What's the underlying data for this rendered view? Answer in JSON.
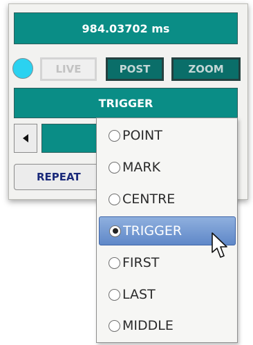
{
  "display": {
    "time": "984.03702 ms"
  },
  "modes": {
    "live": "LIVE",
    "post": "POST",
    "zoom": "ZOOM",
    "led_color": "#2bd2f0"
  },
  "trigger_select": {
    "value": "TRIGGER"
  },
  "repeat_button": {
    "label": "REPEAT"
  },
  "dropdown": {
    "options": [
      "POINT",
      "MARK",
      "CENTRE",
      "TRIGGER",
      "FIRST",
      "LAST",
      "MIDDLE"
    ],
    "selected": "TRIGGER"
  },
  "icons": {
    "scroll_left": "triangle-left-icon",
    "cursor": "pointer-arrow-icon"
  },
  "colors": {
    "teal": "#0a8d86",
    "dark_teal": "#0a6e69",
    "selection": "#5f88c8",
    "repeat_text": "#1b2a7a"
  }
}
